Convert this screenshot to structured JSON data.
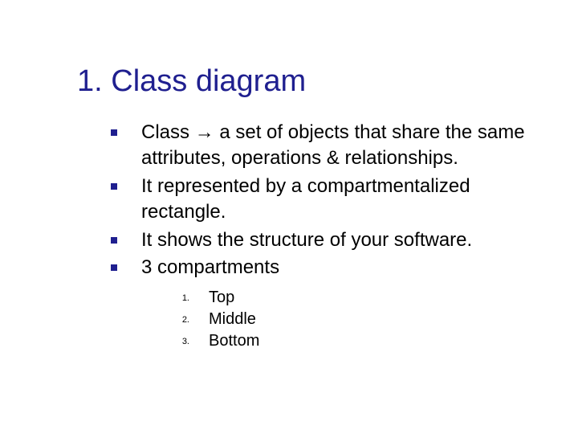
{
  "title": "1. Class diagram",
  "bullets": [
    "Class → a set of objects that share the same attributes, operations & relationships.",
    "It represented by a compartmentalized rectangle.",
    "It shows the structure of your software.",
    "3 compartments"
  ],
  "sub_numbers": [
    "1.",
    "2.",
    "3."
  ],
  "sub_items": [
    "Top",
    "Middle",
    "Bottom"
  ]
}
